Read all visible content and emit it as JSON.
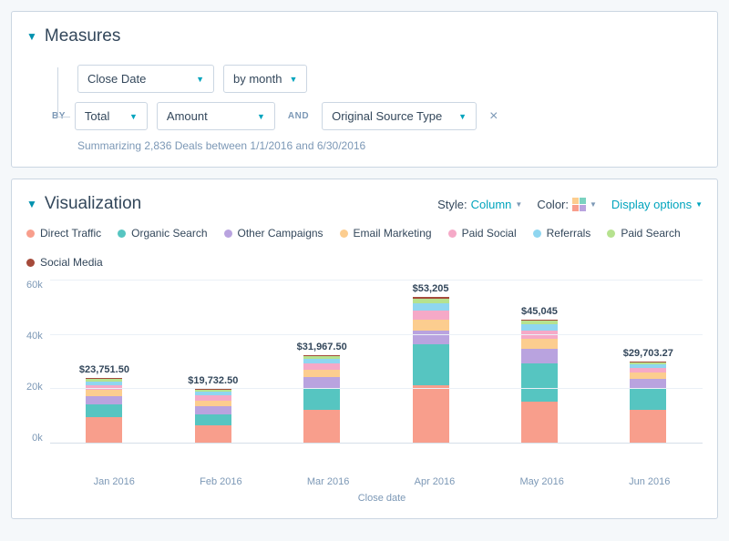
{
  "measures": {
    "title": "Measures",
    "close_date_label": "Close Date",
    "frequency_label": "by month",
    "by_label": "BY",
    "total_label": "Total",
    "amount_label": "Amount",
    "and_label": "AND",
    "source_label": "Original Source Type",
    "summary": "Summarizing 2,836 Deals between 1/1/2016 and 6/30/2016"
  },
  "visualization": {
    "title": "Visualization",
    "style_label": "Style:",
    "style_value": "Column",
    "color_label": "Color:",
    "display_options": "Display options"
  },
  "legend": [
    {
      "name": "Direct Traffic",
      "color": "#f89e8c"
    },
    {
      "name": "Organic Search",
      "color": "#56c5c1"
    },
    {
      "name": "Other Campaigns",
      "color": "#b9a3df"
    },
    {
      "name": "Email Marketing",
      "color": "#fccd8f"
    },
    {
      "name": "Paid Social",
      "color": "#f5a9c7"
    },
    {
      "name": "Referrals",
      "color": "#8fd6f0"
    },
    {
      "name": "Paid Search",
      "color": "#b6e28f"
    },
    {
      "name": "Social Media",
      "color": "#a54a3a"
    }
  ],
  "chart_data": {
    "type": "bar",
    "stacked": true,
    "xlabel": "Close date",
    "ylabel": "",
    "ylim": [
      0,
      60000
    ],
    "y_ticks": [
      "60k",
      "40k",
      "20k",
      "0k"
    ],
    "categories": [
      "Jan 2016",
      "Feb 2016",
      "Mar 2016",
      "Apr 2016",
      "May 2016",
      "Jun 2016"
    ],
    "totals_labels": [
      "$23,751.50",
      "$19,732.50",
      "$31,967.50",
      "$53,205",
      "$45,045",
      "$29,703.27"
    ],
    "totals": [
      23751.5,
      19732.5,
      31967.5,
      53205,
      45045,
      29703.27
    ],
    "series": [
      {
        "name": "Direct Traffic",
        "color": "#f89e8c",
        "values": [
          9500,
          6500,
          12000,
          21000,
          15000,
          12000
        ]
      },
      {
        "name": "Organic Search",
        "color": "#56c5c1",
        "values": [
          4500,
          4000,
          8000,
          15000,
          14000,
          8000
        ]
      },
      {
        "name": "Other Campaigns",
        "color": "#b9a3df",
        "values": [
          3000,
          2800,
          4000,
          5000,
          5500,
          3500
        ]
      },
      {
        "name": "Email Marketing",
        "color": "#fccd8f",
        "values": [
          2200,
          2200,
          2700,
          4000,
          3500,
          2200
        ]
      },
      {
        "name": "Paid Social",
        "color": "#f5a9c7",
        "values": [
          1800,
          1700,
          2200,
          3200,
          3000,
          1700
        ]
      },
      {
        "name": "Referrals",
        "color": "#8fd6f0",
        "values": [
          1500,
          1400,
          1800,
          2800,
          2300,
          1400
        ]
      },
      {
        "name": "Paid Search",
        "color": "#b6e28f",
        "values": [
          900,
          800,
          1000,
          1700,
          1400,
          700
        ]
      },
      {
        "name": "Social Media",
        "color": "#a54a3a",
        "values": [
          351.5,
          332.5,
          267.5,
          505,
          345,
          203.27
        ]
      }
    ]
  }
}
